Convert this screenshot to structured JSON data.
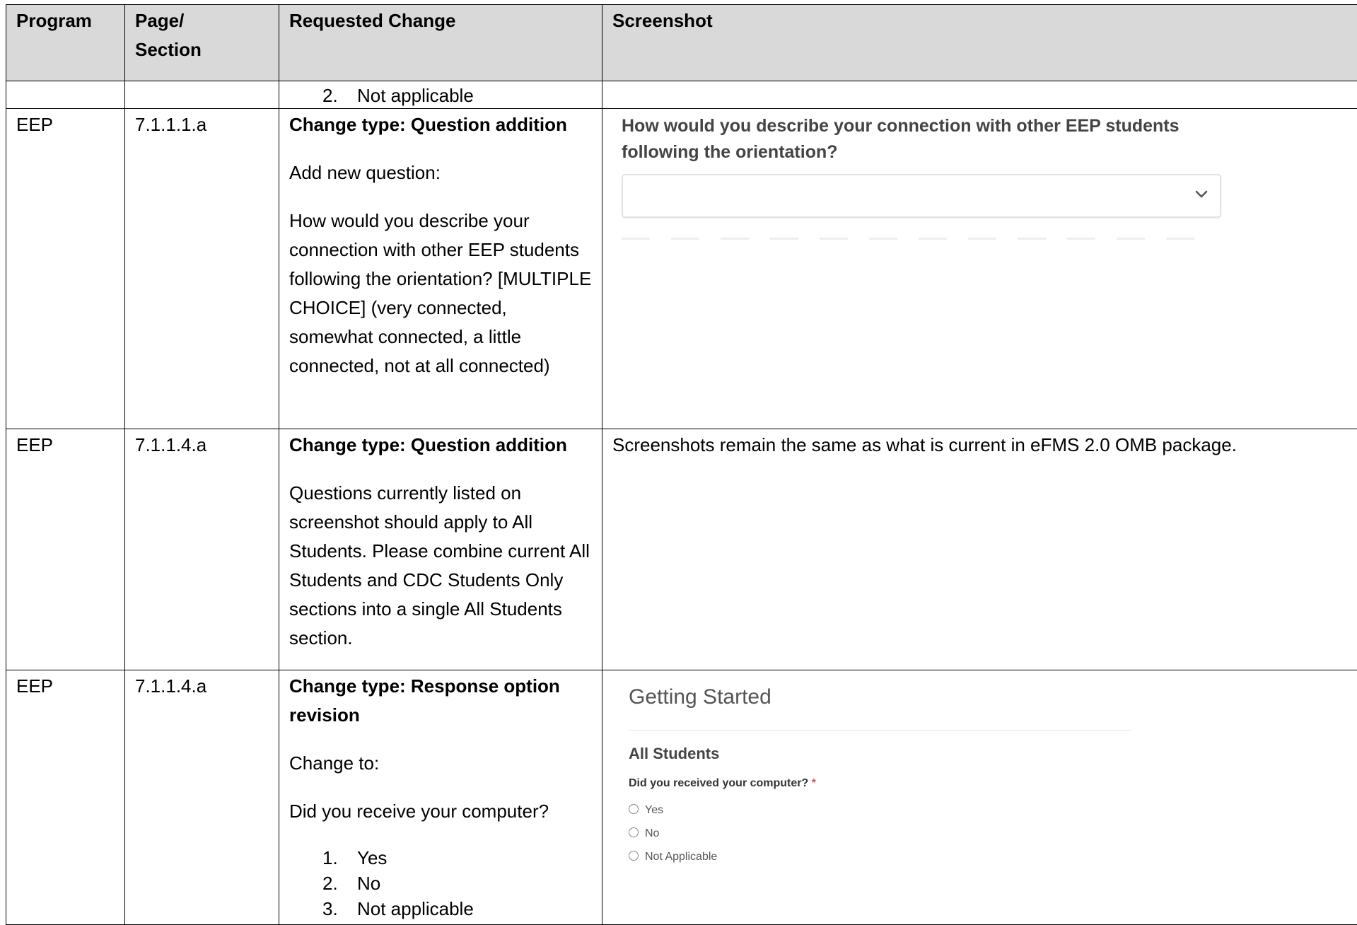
{
  "headers": {
    "program": "Program",
    "page_section": "Page/ Section",
    "requested_change": "Requested Change",
    "screenshot": "Screenshot"
  },
  "row0": {
    "item_num": "2.",
    "item_text": "Not applicable"
  },
  "row1": {
    "program": "EEP",
    "section": "7.1.1.1.a",
    "change_type": "Change type: Question addition",
    "intro": "Add new question:",
    "body": "How would you describe your connection with other EEP students following the orientation? [MULTIPLE CHOICE] (very connected, somewhat connected, a little connected, not at all connected)",
    "shot_question": "How would you describe your connection with other EEP students following the orientation?",
    "shot_select_icon": "chevron-down-icon"
  },
  "row2": {
    "program": "EEP",
    "section": "7.1.1.4.a",
    "change_type": "Change type: Question addition",
    "body": "Questions currently listed on screenshot should apply to All Students. Please combine current All Students and CDC Students Only sections into a single All Students section.",
    "screenshot_note": "Screenshots remain the same as what is current in eFMS 2.0 OMB package."
  },
  "row3": {
    "program": "EEP",
    "section": "7.1.1.4.a",
    "change_type": "Change type: Response option revision",
    "intro": "Change to:",
    "question": "Did you receive your computer?",
    "options": [
      {
        "num": "1.",
        "text": "Yes"
      },
      {
        "num": "2.",
        "text": "No"
      },
      {
        "num": "3.",
        "text": "Not applicable"
      }
    ],
    "shot_title": "Getting Started",
    "shot_section": "All Students",
    "shot_question": "Did you received your computer?",
    "shot_required": "*",
    "shot_options": [
      "Yes",
      "No",
      "Not Applicable"
    ]
  }
}
